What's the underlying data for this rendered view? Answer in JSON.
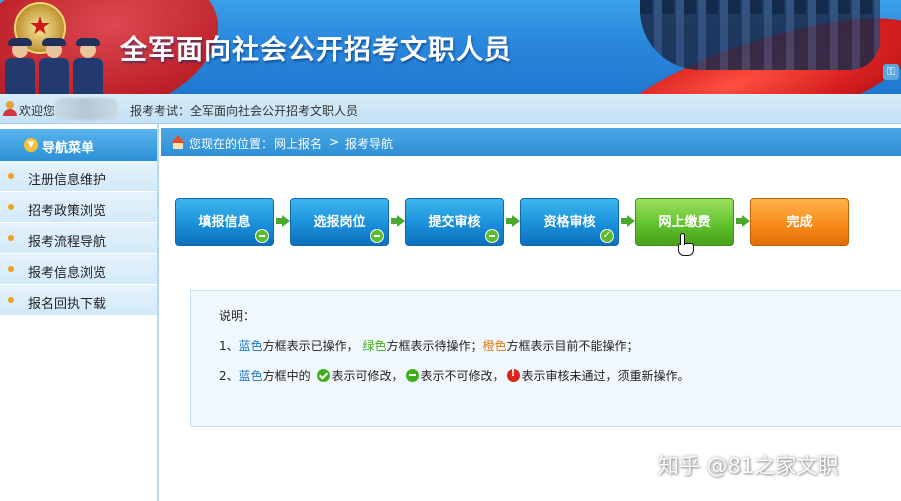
{
  "banner": {
    "title": "全军面向社会公开招考文职人员",
    "colors": {
      "sky": "#2a88dc",
      "flag": "#d01818"
    }
  },
  "welcome_bar": {
    "welcome_text": "欢迎您",
    "exam_text": "报考考试：全军面向社会公开招考文职人员"
  },
  "sidebar": {
    "header": "导航菜单",
    "items": [
      {
        "label": "注册信息维护"
      },
      {
        "label": "招考政策浏览"
      },
      {
        "label": "报考流程导航"
      },
      {
        "label": "报考信息浏览"
      },
      {
        "label": "报名回执下载"
      }
    ]
  },
  "breadcrumb": {
    "label": "您现在的位置：",
    "level1": "网上报名",
    "separator": ">",
    "level2": "报考导航"
  },
  "steps": [
    {
      "label": "填报信息",
      "color": "blue",
      "status_icon": "minus-icon"
    },
    {
      "label": "选报岗位",
      "color": "blue",
      "status_icon": "minus-icon"
    },
    {
      "label": "提交审核",
      "color": "blue",
      "status_icon": "minus-icon"
    },
    {
      "label": "资格审核",
      "color": "blue",
      "status_icon": "check-icon"
    },
    {
      "label": "网上缴费",
      "color": "green",
      "status_icon": ""
    },
    {
      "label": "完成",
      "color": "orange",
      "status_icon": ""
    }
  ],
  "notes": {
    "title": "说明：",
    "line1": {
      "prefix": "1、",
      "blue": "蓝色",
      "t1": "方框表示已操作，",
      "green": "绿色",
      "t2": "方框表示待操作；",
      "orange": "橙色",
      "t3": "方框表示目前不能操作；"
    },
    "line2": {
      "prefix": "2、",
      "blue": "蓝色",
      "t1": "方框中的",
      "t2": "表示可修改，",
      "t3": "表示不可修改，",
      "t4": "表示审核未通过，须重新操作。"
    }
  },
  "watermark": "知乎 @81之家文职"
}
